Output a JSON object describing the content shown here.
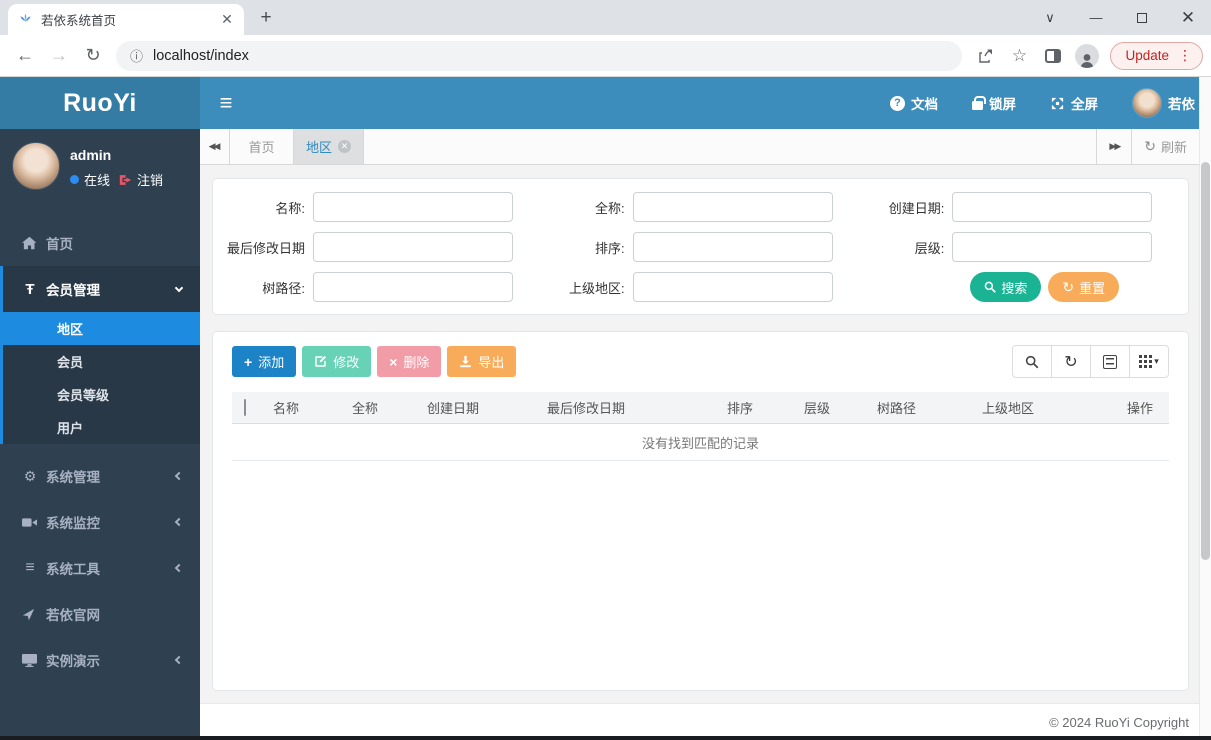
{
  "browser": {
    "tab_title": "若依系统首页",
    "url": "localhost/index",
    "update_label": "Update"
  },
  "header": {
    "logo": "RuoYi",
    "docs_label": "文档",
    "lock_label": "锁屏",
    "fullscreen_label": "全屏",
    "user_label": "若依"
  },
  "sidebar": {
    "user": {
      "name": "admin",
      "status": "在线",
      "logout": "注销"
    },
    "items": {
      "home": "首页",
      "member": "会员管理",
      "system": "系统管理",
      "monitor": "系统监控",
      "tools": "系统工具",
      "site": "若依官网",
      "demo": "实例演示"
    },
    "member_children": {
      "region": "地区",
      "member": "会员",
      "level": "会员等级",
      "user": "用户"
    }
  },
  "tab_bar": {
    "tabs": [
      {
        "label": "首页"
      },
      {
        "label": "地区"
      }
    ],
    "refresh_label": "刷新"
  },
  "search_form": {
    "fields": [
      {
        "label": "名称:"
      },
      {
        "label": "全称:"
      },
      {
        "label": "创建日期:"
      },
      {
        "label": "最后修改日期"
      },
      {
        "label": "排序:"
      },
      {
        "label": "层级:"
      },
      {
        "label": "树路径:"
      },
      {
        "label": "上级地区:"
      }
    ],
    "search_label": "搜索",
    "reset_label": "重置"
  },
  "toolbar": {
    "add_label": "添加",
    "edit_label": "修改",
    "delete_label": "删除",
    "export_label": "导出"
  },
  "table": {
    "columns": [
      "名称",
      "全称",
      "创建日期",
      "最后修改日期",
      "排序",
      "层级",
      "树路径",
      "上级地区",
      "操作"
    ],
    "empty_text": "没有找到匹配的记录"
  },
  "footer": {
    "copyright": "© 2024 RuoYi Copyright"
  },
  "colors": {
    "header_blue": "#3c8dbc",
    "logo_blue": "#357ca5",
    "sidebar_dark": "#2f4050",
    "submenu_dark": "#293846",
    "active_blue": "#1d8ce0",
    "success_teal": "#1ab394",
    "warning_orange": "#f8ac59",
    "info_blue": "#1c84c6",
    "danger_pink": "#f19ca6"
  }
}
